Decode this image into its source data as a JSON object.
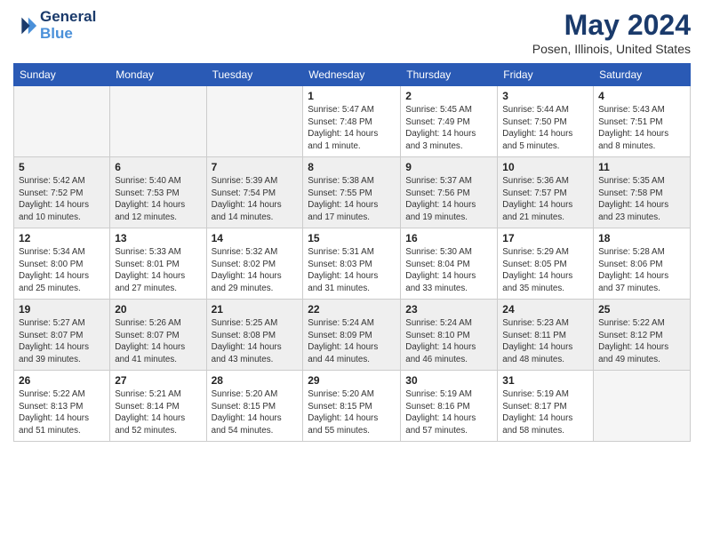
{
  "header": {
    "logo_line1": "General",
    "logo_line2": "Blue",
    "month": "May 2024",
    "location": "Posen, Illinois, United States"
  },
  "weekdays": [
    "Sunday",
    "Monday",
    "Tuesday",
    "Wednesday",
    "Thursday",
    "Friday",
    "Saturday"
  ],
  "weeks": [
    [
      {
        "day": "",
        "empty": true
      },
      {
        "day": "",
        "empty": true
      },
      {
        "day": "",
        "empty": true
      },
      {
        "day": "1",
        "info": "Sunrise: 5:47 AM\nSunset: 7:48 PM\nDaylight: 14 hours\nand 1 minute."
      },
      {
        "day": "2",
        "info": "Sunrise: 5:45 AM\nSunset: 7:49 PM\nDaylight: 14 hours\nand 3 minutes."
      },
      {
        "day": "3",
        "info": "Sunrise: 5:44 AM\nSunset: 7:50 PM\nDaylight: 14 hours\nand 5 minutes."
      },
      {
        "day": "4",
        "info": "Sunrise: 5:43 AM\nSunset: 7:51 PM\nDaylight: 14 hours\nand 8 minutes."
      }
    ],
    [
      {
        "day": "5",
        "info": "Sunrise: 5:42 AM\nSunset: 7:52 PM\nDaylight: 14 hours\nand 10 minutes."
      },
      {
        "day": "6",
        "info": "Sunrise: 5:40 AM\nSunset: 7:53 PM\nDaylight: 14 hours\nand 12 minutes."
      },
      {
        "day": "7",
        "info": "Sunrise: 5:39 AM\nSunset: 7:54 PM\nDaylight: 14 hours\nand 14 minutes."
      },
      {
        "day": "8",
        "info": "Sunrise: 5:38 AM\nSunset: 7:55 PM\nDaylight: 14 hours\nand 17 minutes."
      },
      {
        "day": "9",
        "info": "Sunrise: 5:37 AM\nSunset: 7:56 PM\nDaylight: 14 hours\nand 19 minutes."
      },
      {
        "day": "10",
        "info": "Sunrise: 5:36 AM\nSunset: 7:57 PM\nDaylight: 14 hours\nand 21 minutes."
      },
      {
        "day": "11",
        "info": "Sunrise: 5:35 AM\nSunset: 7:58 PM\nDaylight: 14 hours\nand 23 minutes."
      }
    ],
    [
      {
        "day": "12",
        "info": "Sunrise: 5:34 AM\nSunset: 8:00 PM\nDaylight: 14 hours\nand 25 minutes."
      },
      {
        "day": "13",
        "info": "Sunrise: 5:33 AM\nSunset: 8:01 PM\nDaylight: 14 hours\nand 27 minutes."
      },
      {
        "day": "14",
        "info": "Sunrise: 5:32 AM\nSunset: 8:02 PM\nDaylight: 14 hours\nand 29 minutes."
      },
      {
        "day": "15",
        "info": "Sunrise: 5:31 AM\nSunset: 8:03 PM\nDaylight: 14 hours\nand 31 minutes."
      },
      {
        "day": "16",
        "info": "Sunrise: 5:30 AM\nSunset: 8:04 PM\nDaylight: 14 hours\nand 33 minutes."
      },
      {
        "day": "17",
        "info": "Sunrise: 5:29 AM\nSunset: 8:05 PM\nDaylight: 14 hours\nand 35 minutes."
      },
      {
        "day": "18",
        "info": "Sunrise: 5:28 AM\nSunset: 8:06 PM\nDaylight: 14 hours\nand 37 minutes."
      }
    ],
    [
      {
        "day": "19",
        "info": "Sunrise: 5:27 AM\nSunset: 8:07 PM\nDaylight: 14 hours\nand 39 minutes."
      },
      {
        "day": "20",
        "info": "Sunrise: 5:26 AM\nSunset: 8:07 PM\nDaylight: 14 hours\nand 41 minutes."
      },
      {
        "day": "21",
        "info": "Sunrise: 5:25 AM\nSunset: 8:08 PM\nDaylight: 14 hours\nand 43 minutes."
      },
      {
        "day": "22",
        "info": "Sunrise: 5:24 AM\nSunset: 8:09 PM\nDaylight: 14 hours\nand 44 minutes."
      },
      {
        "day": "23",
        "info": "Sunrise: 5:24 AM\nSunset: 8:10 PM\nDaylight: 14 hours\nand 46 minutes."
      },
      {
        "day": "24",
        "info": "Sunrise: 5:23 AM\nSunset: 8:11 PM\nDaylight: 14 hours\nand 48 minutes."
      },
      {
        "day": "25",
        "info": "Sunrise: 5:22 AM\nSunset: 8:12 PM\nDaylight: 14 hours\nand 49 minutes."
      }
    ],
    [
      {
        "day": "26",
        "info": "Sunrise: 5:22 AM\nSunset: 8:13 PM\nDaylight: 14 hours\nand 51 minutes."
      },
      {
        "day": "27",
        "info": "Sunrise: 5:21 AM\nSunset: 8:14 PM\nDaylight: 14 hours\nand 52 minutes."
      },
      {
        "day": "28",
        "info": "Sunrise: 5:20 AM\nSunset: 8:15 PM\nDaylight: 14 hours\nand 54 minutes."
      },
      {
        "day": "29",
        "info": "Sunrise: 5:20 AM\nSunset: 8:15 PM\nDaylight: 14 hours\nand 55 minutes."
      },
      {
        "day": "30",
        "info": "Sunrise: 5:19 AM\nSunset: 8:16 PM\nDaylight: 14 hours\nand 57 minutes."
      },
      {
        "day": "31",
        "info": "Sunrise: 5:19 AM\nSunset: 8:17 PM\nDaylight: 14 hours\nand 58 minutes."
      },
      {
        "day": "",
        "empty": true
      }
    ]
  ]
}
